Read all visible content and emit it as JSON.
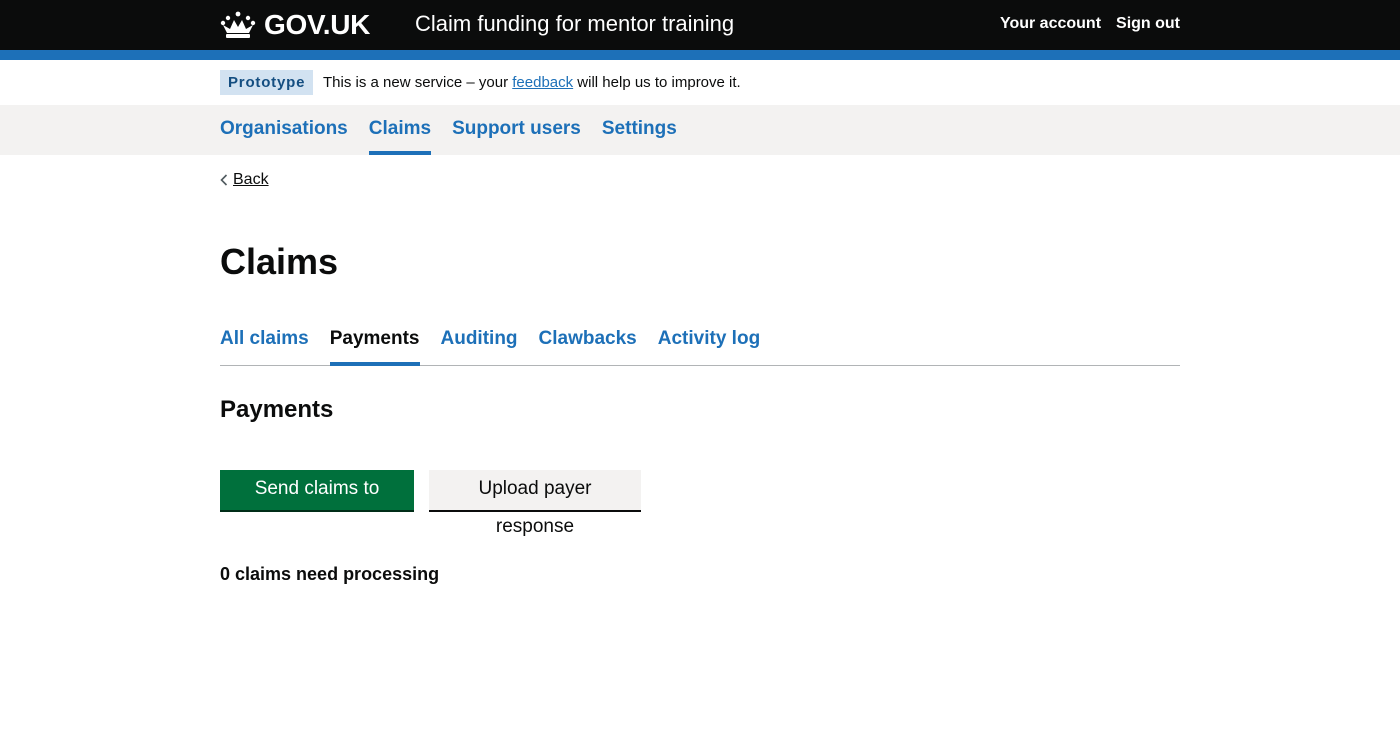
{
  "header": {
    "logo_text": "GOV.UK",
    "logo_icon": "crown-icon",
    "service_name": "Claim funding for mentor training",
    "nav": [
      "Your account",
      "Sign out"
    ]
  },
  "phase_banner": {
    "tag": "Prototype",
    "text_before": "This is a new service – your ",
    "link_text": "feedback",
    "text_after": " will help us to improve it."
  },
  "service_nav": {
    "items": [
      "Organisations",
      "Claims",
      "Support users",
      "Settings"
    ],
    "active": "Claims"
  },
  "back_link": {
    "label": "Back",
    "icon": "chevron-left-icon"
  },
  "page_title": "Claims",
  "tabs": {
    "items": [
      "All claims",
      "Payments",
      "Auditing",
      "Clawbacks",
      "Activity log"
    ],
    "active": "Payments"
  },
  "section_title": "Payments",
  "buttons": {
    "primary": "Send claims to payer",
    "secondary": "Upload payer response"
  },
  "claims_count_text": "0 claims need processing",
  "colors": {
    "header_bg": "#0b0c0c",
    "brand_blue": "#1d70b8",
    "link": "#1d70b8",
    "primary_button": "#00703c",
    "secondary_button": "#f3f2f1",
    "nav_bg": "#f3f2f1",
    "tag_bg": "#d2e2f1"
  }
}
